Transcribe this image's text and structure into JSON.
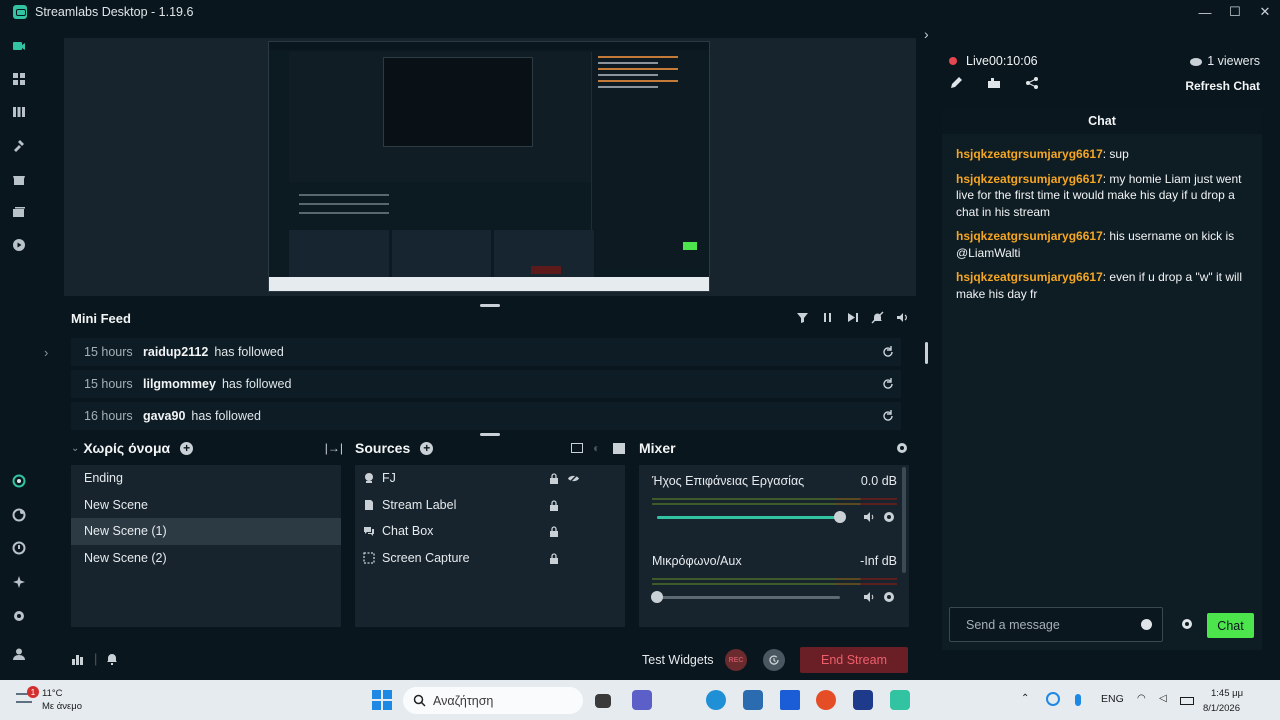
{
  "app": {
    "title": "Streamlabs Desktop - 1.19.6"
  },
  "window_controls": {
    "minimize": "—",
    "maximize": "☐",
    "close": "✕"
  },
  "left_nav": [
    "editor-icon",
    "dashboard-icon",
    "library-icon",
    "themes-icon",
    "store-icon",
    "overlay-icon",
    "play-icon",
    "alerts-icon",
    "ideas-icon",
    "apps-icon",
    "sparkle-icon",
    "settings-icon",
    "profile-icon"
  ],
  "mini_feed": {
    "title": "Mini Feed",
    "items": [
      {
        "time": "15 hours",
        "user": "raidup2112",
        "action": "has followed"
      },
      {
        "time": "15 hours",
        "user": "lilgmommey",
        "action": "has followed"
      },
      {
        "time": "16 hours",
        "user": "gava90",
        "action": "has followed"
      }
    ]
  },
  "scenes": {
    "title": "Χωρίς όνομα",
    "items": [
      "Ending",
      "New Scene",
      "New Scene (1)",
      "New Scene (2)"
    ],
    "active_index": 2
  },
  "sources": {
    "title": "Sources",
    "items": [
      {
        "name": "FJ",
        "icon": "webcam-icon"
      },
      {
        "name": "Stream Label",
        "icon": "text-icon"
      },
      {
        "name": "Chat Box",
        "icon": "chat-icon"
      },
      {
        "name": "Screen Capture",
        "icon": "capture-icon"
      }
    ]
  },
  "mixer": {
    "title": "Mixer",
    "channels": [
      {
        "name": "Ήχος Επιφάνειας Εργασίας",
        "db": "0.0 dB",
        "level": 1.0
      },
      {
        "name": "Μικρόφωνο/Aux",
        "db": "-Inf dB",
        "level": 0.0
      }
    ]
  },
  "footer": {
    "test_widgets": "Test Widgets",
    "rec": "REC",
    "end_stream": "End Stream"
  },
  "chat": {
    "live_label": "Live",
    "live_time": "00:10:06",
    "viewers": "1 viewers",
    "refresh": "Refresh Chat",
    "title": "Chat",
    "messages": [
      {
        "user": "hsjqkzeatgrsumjaryg6617",
        "text": "sup"
      },
      {
        "user": "hsjqkzeatgrsumjaryg6617",
        "text": "my homie Liam just went live for the first time it would make his day if u drop a chat in his stream"
      },
      {
        "user": "hsjqkzeatgrsumjaryg6617",
        "text": "his username on kick is @LiamWalti"
      },
      {
        "user": "hsjqkzeatgrsumjaryg6617",
        "text": "even if u drop a \"w\" it will make his day fr"
      }
    ],
    "input_placeholder": "Send a message",
    "send_label": "Chat"
  },
  "taskbar": {
    "weather_badge": "1",
    "weather_temp": "11°C",
    "weather_desc": "Με άνεμο",
    "search_placeholder": "Αναζήτηση",
    "language": "ENG",
    "time": "1:45 μμ",
    "date": "8/1/2026"
  },
  "colors": {
    "accent": "#31c3a2",
    "chat_user": "#f5a623",
    "chat_button": "#4ce54c",
    "end_stream": "#6a1f26",
    "live": "#e5464f"
  }
}
